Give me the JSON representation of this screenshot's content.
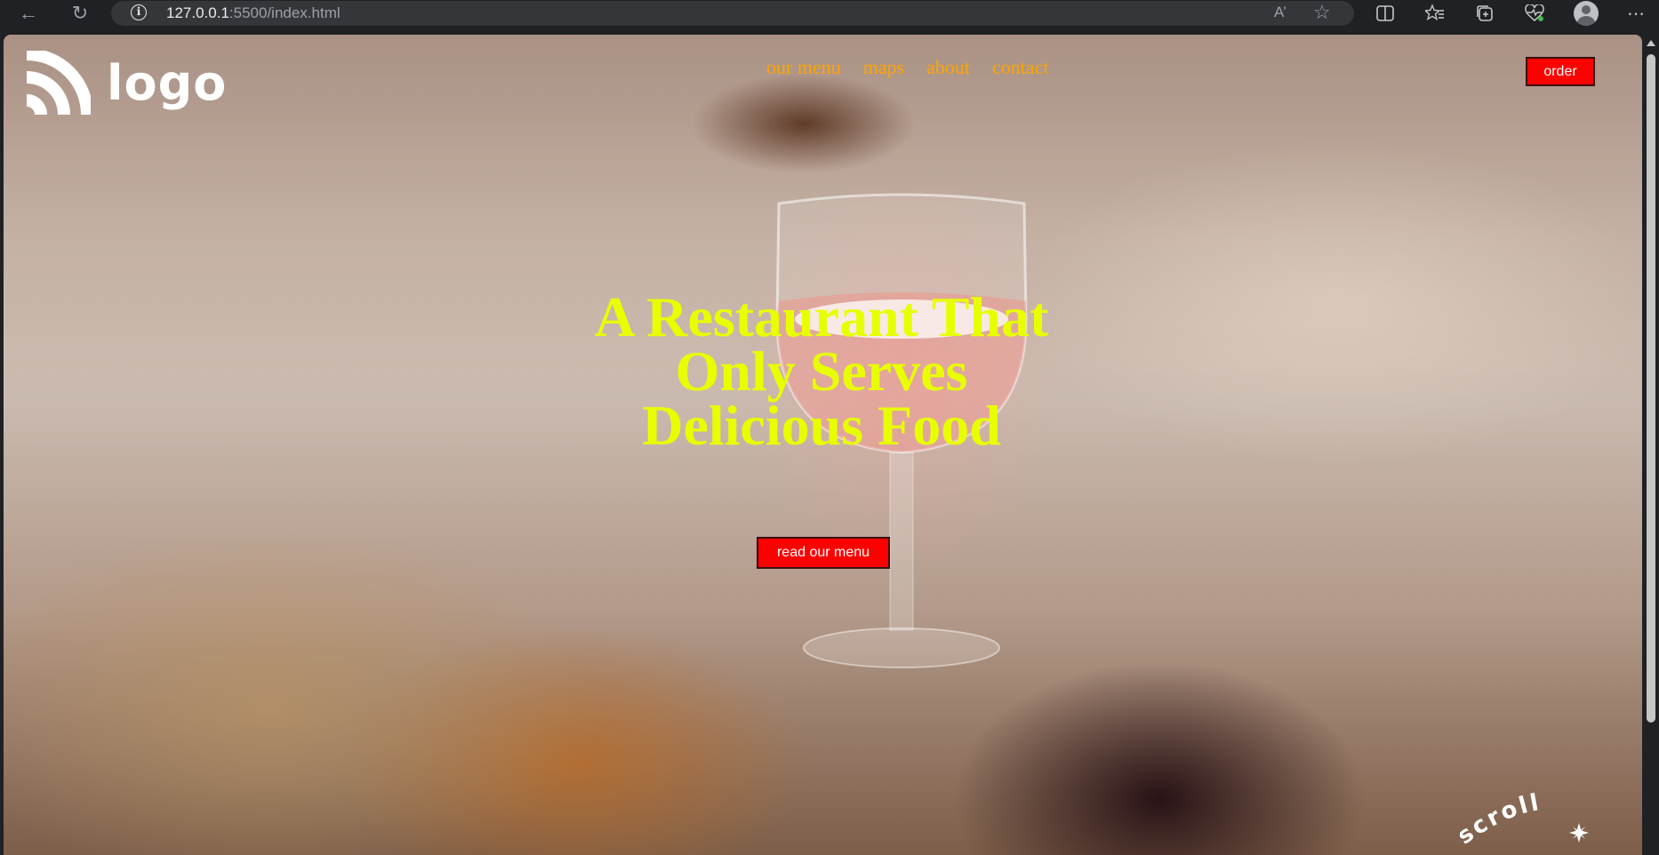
{
  "browser": {
    "url_host": "127.0.0.1",
    "url_path": ":5500/index.html",
    "read_aloud_glyph": "A’",
    "back_icon": "back-arrow-icon",
    "reload_icon": "reload-icon"
  },
  "site": {
    "logo_text": "logo",
    "nav": [
      "our menu",
      "maps",
      "about",
      "contact"
    ],
    "order_label": "order",
    "hero_lines": [
      "A Restaurant That",
      "Only Serves",
      "Delicious Food"
    ],
    "menu_button_label": "read our menu",
    "scroll_badge_text": "scroll",
    "colors": {
      "nav": "#ffa500",
      "hero": "#e8ff00",
      "button_bg": "#ff0000",
      "button_text": "#ffffff"
    }
  }
}
